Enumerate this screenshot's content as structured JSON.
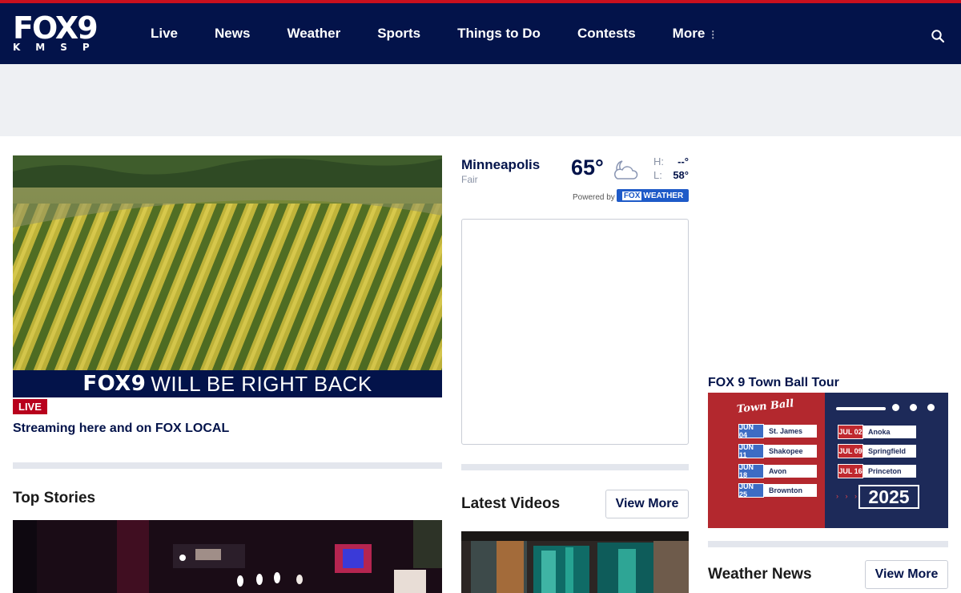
{
  "header": {
    "logo_main": "FOX9",
    "logo_sub": "KMSP",
    "nav": [
      "Live",
      "News",
      "Weather",
      "Sports",
      "Things to Do",
      "Contests",
      "More"
    ],
    "more_dots": "⋮",
    "colors": {
      "bar": "#03134a",
      "accent": "#c8101e"
    }
  },
  "hero": {
    "banner_brand": "FOX9",
    "banner_text": "WILL BE RIGHT BACK",
    "live_label": "LIVE",
    "caption": "Streaming here and on FOX LOCAL"
  },
  "top_stories": {
    "title": "Top Stories"
  },
  "weather": {
    "city": "Minneapolis",
    "condition": "Fair",
    "temp": "65°",
    "icon": "moon-cloud-icon",
    "high_label": "H:",
    "high_value": "--°",
    "low_label": "L:",
    "low_value": "58°",
    "powered_by": "Powered by",
    "badge_brand": "FOX",
    "badge_text": "WEATHER"
  },
  "latest_videos": {
    "title": "Latest Videos",
    "view_more": "View More"
  },
  "town_ball": {
    "title": "FOX 9 Town Ball Tour",
    "logo": "Town Ball",
    "left_dates": [
      {
        "date": "JUN 04",
        "place": "St. James"
      },
      {
        "date": "JUN 11",
        "place": "Shakopee"
      },
      {
        "date": "JUN 18",
        "place": "Avon"
      },
      {
        "date": "JUN 25",
        "place": "Brownton"
      }
    ],
    "right_dates": [
      {
        "date": "JUL 02",
        "place": "Anoka"
      },
      {
        "date": "JUL 09",
        "place": "Springfield"
      },
      {
        "date": "JUL 16",
        "place": "Princeton"
      }
    ],
    "year": "2025",
    "arrows": "› › ›"
  },
  "weather_news": {
    "title": "Weather News",
    "view_more": "View More"
  }
}
